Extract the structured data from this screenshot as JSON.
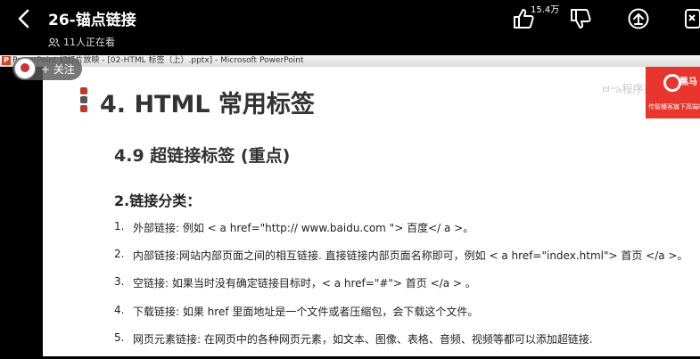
{
  "player": {
    "title": "26-锚点链接",
    "viewers": "11人正在看",
    "like_count": "15.4万"
  },
  "follow": {
    "label": "+ 关注"
  },
  "ppt_window": {
    "title": "PowerPoint 幻灯片放映 - [02-HTML 标签（上）.pptx] - Microsoft PowerPoint",
    "app_icon": "P"
  },
  "slide": {
    "heading": "4. HTML 常用标签",
    "section": "4.9 超链接标签 (重点)",
    "subtitle": "2.链接分类：",
    "items": [
      {
        "num": "1.",
        "text": "外部链接: 例如 < a href=\"http:// www.baidu.com \"> 百度</ a >。"
      },
      {
        "num": "2.",
        "text": "内部链接:网站内部页面之间的相互链接. 直接链接内部页面名称即可，例如 < a href=\"index.html\"> 首页 </a >。"
      },
      {
        "num": "3.",
        "text": "空链接: 如果当时没有确定链接目标时，< a href=\"#\"> 首页 </a > 。"
      },
      {
        "num": "4.",
        "text": "下载链接: 如果 href 里面地址是一个文件或者压缩包，会下载这个文件。"
      },
      {
        "num": "5.",
        "text": "网页元素链接: 在网页中的各种网页元素，如文本、图像、表格、音频、视频等都可以添加超链接."
      }
    ],
    "watermark": "ㅂ᠆৯程序员",
    "brand": {
      "name": "黑马",
      "slogan": "传智播客旗下高端IT"
    }
  },
  "colors": {
    "brand_red": "#e8362e",
    "bullet_colors": [
      "#c0392b",
      "#555555",
      "#c0392b"
    ]
  },
  "icons": [
    "back-arrow-icon",
    "viewers-icon",
    "thumbs-up-icon",
    "thumbs-down-icon",
    "share-icon",
    "more-icon"
  ]
}
